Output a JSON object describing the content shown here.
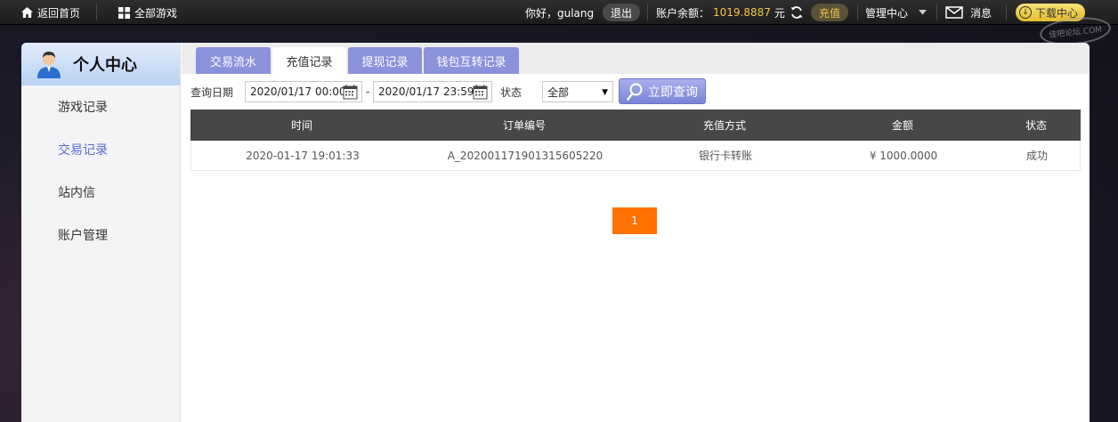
{
  "topbar": {
    "home_label": "返回首页",
    "all_games_label": "全部游戏",
    "greeting": "你好，gulang",
    "logout_label": "退出",
    "balance_label": "账户余额：",
    "balance_value": "1019.8887",
    "balance_unit": "元",
    "recharge_label": "充值",
    "manage_label": "管理中心",
    "message_label": "消息",
    "download_label": "下载中心"
  },
  "watermark": "佳吧论坛.COM",
  "sidebar": {
    "title": "个人中心",
    "items": [
      {
        "label": "游戏记录"
      },
      {
        "label": "交易记录"
      },
      {
        "label": "站内信"
      },
      {
        "label": "账户管理"
      }
    ]
  },
  "tabs": [
    {
      "label": "交易流水"
    },
    {
      "label": "充值记录"
    },
    {
      "label": "提现记录"
    },
    {
      "label": "钱包互转记录"
    }
  ],
  "filter": {
    "date_label": "查询日期",
    "start_date": "2020/01/17 00:00",
    "dash": "-",
    "end_date": "2020/01/17 23:59",
    "status_label": "状态",
    "status_value": "全部",
    "query_label": "立即查询"
  },
  "table": {
    "columns": [
      "时间",
      "订单编号",
      "充值方式",
      "金额",
      "状态"
    ],
    "rows": [
      [
        "2020-01-17 19:01:33",
        "A_202001171901315605220",
        "银行卡转账",
        "¥ 1000.0000",
        "成功"
      ]
    ]
  },
  "pagination": {
    "current": "1"
  },
  "colors": {
    "accent": "#8b92dc",
    "active_text": "#5b6ad2",
    "balance": "#f3c84a",
    "pager": "#ff7100",
    "table_header": "#474747"
  }
}
